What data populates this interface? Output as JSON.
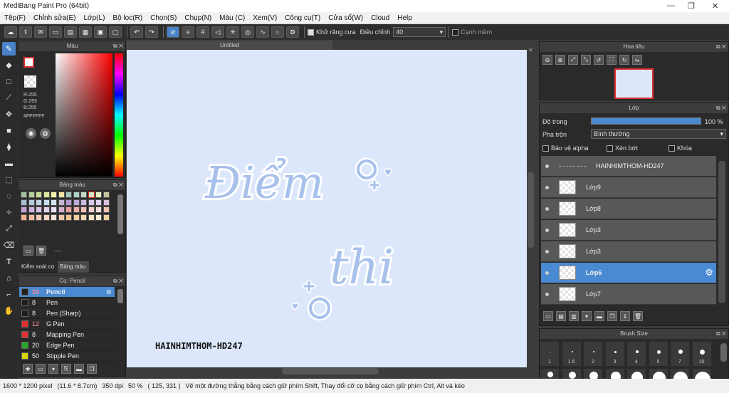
{
  "window": {
    "title": "MediBang Paint Pro (64bit)"
  },
  "menu": [
    "Tệp(F)",
    "Chỉnh sửa(E)",
    "Lớp(L)",
    "Bộ lọc(R)",
    "Chọn(S)",
    "Chụp(N)",
    "Màu (C)",
    "Xem(V)",
    "Công cụ(T)",
    "Cửa sổ(W)",
    "Cloud",
    "Help"
  ],
  "toolbar": {
    "antialias_label": "Khử răng cưa",
    "adjust_label": "Điều chỉnh",
    "adjust_value": "40",
    "edge_label": "Cạnh mềm"
  },
  "color_panel": {
    "title": "Màu",
    "r": "R:255",
    "g": "G:255",
    "b": "B:255",
    "hex": "#FFFFFF"
  },
  "palette_panel": {
    "title": "Bảng màu",
    "dash": "---",
    "tab_control": "Kiểm soát cọ",
    "tab_palette": "Bảng màu"
  },
  "palette_colors": [
    "#9fbfa0",
    "#b3cf9d",
    "#c7dc99",
    "#dfe89c",
    "#f0f0a8",
    "#f6e3a6",
    "#9fc5b8",
    "#a9d4c1",
    "#bfdcc3",
    "#d4e6c1",
    "#e8efbf",
    "#c4c49a",
    "#a7bfd2",
    "#b1c9dd",
    "#bcd3e8",
    "#c9dced",
    "#d4e3f1",
    "#c2b7d2",
    "#b39ad2",
    "#c0a9dc",
    "#cab9e1",
    "#d7c9e8",
    "#e1d4ee",
    "#dac0d9",
    "#c3a4d9",
    "#cdb3df",
    "#d8c2e5",
    "#e2d1eb",
    "#ecdff1",
    "#d7aed0",
    "#e8a09b",
    "#eeb0a9",
    "#f3c0b9",
    "#f6d0c9",
    "#f8dfd8",
    "#f2c2b0",
    "#f0b090",
    "#f3bea2",
    "#f6cbb4",
    "#f8d8c6",
    "#fae4d8",
    "#f4c7a7",
    "#f3c48f",
    "#f6cfa1",
    "#f8dab3",
    "#fae4c6",
    "#fcefd9",
    "#f1d2a2"
  ],
  "brush_panel": {
    "title": "Cọ: Pencil",
    "items": [
      {
        "size": "10",
        "name": "Pencil",
        "color": "#1e1e1e"
      },
      {
        "size": "8",
        "name": "Pen",
        "color": "#1e1e1e"
      },
      {
        "size": "8",
        "name": "Pen (Sharp)",
        "color": "#1e1e1e"
      },
      {
        "size": "12",
        "name": "G Pen",
        "color": "#e03030"
      },
      {
        "size": "8",
        "name": "Mapping Pen",
        "color": "#e03030"
      },
      {
        "size": "20",
        "name": "Edge Pen",
        "color": "#2aa82a"
      },
      {
        "size": "50",
        "name": "Stipple Pen",
        "color": "#d8d800"
      }
    ]
  },
  "document": {
    "tab": "Untitled",
    "text1": "Điểm",
    "text2": "thi",
    "credit": "HAINHIMTHOM-HD247"
  },
  "navigator": {
    "title": "Hoa tiêu"
  },
  "layer_panel": {
    "title": "Lớp",
    "opacity_label": "Độ trong",
    "opacity_value": "100 %",
    "blend_label": "Pha trộn",
    "blend_value": "Bình thường",
    "protect_alpha": "Bảo vệ alpha",
    "clipping": "Xén bớt",
    "lock": "Khóa",
    "layers": [
      {
        "name": "HAINHIMTHOM-HD247"
      },
      {
        "name": "Lớp9"
      },
      {
        "name": "Lớp8"
      },
      {
        "name": "Lớp3"
      },
      {
        "name": "Lớp3"
      },
      {
        "name": "Lớp6"
      },
      {
        "name": "Lớp7"
      }
    ]
  },
  "brush_size": {
    "title": "Brush Size",
    "sizes": [
      "1",
      "1.5",
      "2",
      "3",
      "4",
      "5",
      "7",
      "10"
    ]
  },
  "status": {
    "dims": "1600 * 1200 pixel",
    "phys": "(11.6 * 8.7cm)",
    "dpi": "350 dpi",
    "zoom": "50 %",
    "coords": "( 125, 331 )",
    "hint": "Vẽ một đường thẳng bằng cách giữ phím Shift, Thay đổi cỡ cọ bằng cách giữ phím Ctrl, Alt và kéo"
  },
  "colors": {
    "accent": "#4a8ad2",
    "canvas_bg": "#dce7fb",
    "lettering": "#a7c1ea"
  }
}
